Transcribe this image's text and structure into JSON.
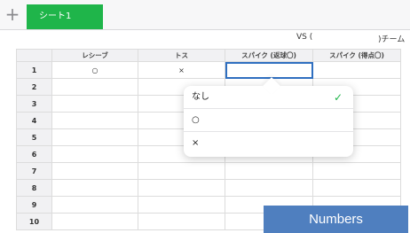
{
  "toolbar": {
    "add_label": "+",
    "sheet_tab": "シート1"
  },
  "header": {
    "vs_left": "VS (",
    "vs_right": ")チーム"
  },
  "table": {
    "columns": [
      "",
      "レシーブ",
      "トス",
      "スパイク (返球〇)",
      "スパイク (得点〇)"
    ],
    "rows": [
      {
        "num": "1",
        "cells": [
          "○",
          "×",
          "",
          ""
        ]
      },
      {
        "num": "2",
        "cells": [
          "",
          "",
          "",
          ""
        ]
      },
      {
        "num": "3",
        "cells": [
          "",
          "",
          "",
          ""
        ]
      },
      {
        "num": "4",
        "cells": [
          "",
          "",
          "",
          ""
        ]
      },
      {
        "num": "5",
        "cells": [
          "",
          "",
          "",
          ""
        ]
      },
      {
        "num": "6",
        "cells": [
          "",
          "",
          "",
          ""
        ]
      },
      {
        "num": "7",
        "cells": [
          "",
          "",
          "",
          ""
        ]
      },
      {
        "num": "8",
        "cells": [
          "",
          "",
          "",
          ""
        ]
      },
      {
        "num": "9",
        "cells": [
          "",
          "",
          "",
          ""
        ]
      },
      {
        "num": "10",
        "cells": [
          "",
          "",
          "",
          ""
        ]
      }
    ]
  },
  "popover": {
    "options": [
      {
        "label": "なし",
        "selected": true
      },
      {
        "label": "○"
      },
      {
        "label": "×"
      }
    ],
    "check_icon": "✓"
  },
  "badge": {
    "label": "Numbers"
  },
  "colors": {
    "accent": "#1fb54a",
    "selection": "#2f6fc0",
    "badge": "#4f7fbf"
  }
}
